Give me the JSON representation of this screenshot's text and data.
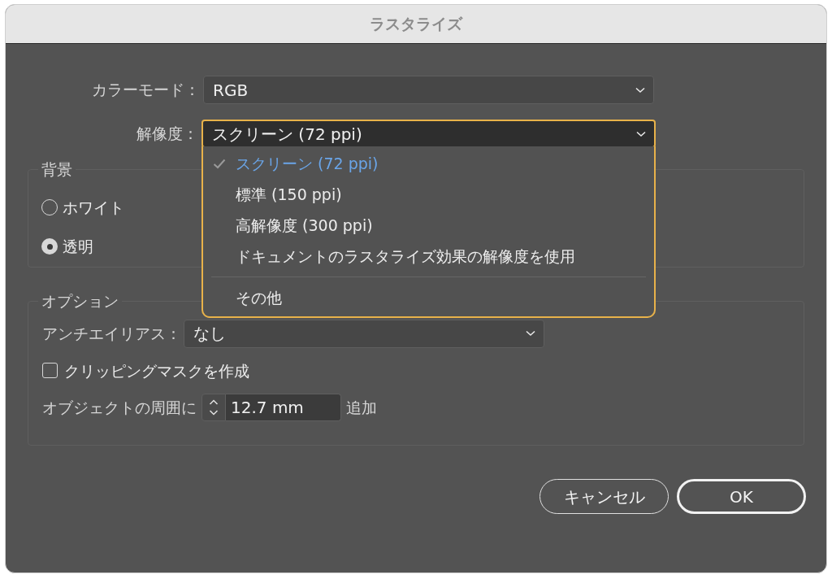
{
  "window": {
    "title": "ラスタライズ"
  },
  "color_mode": {
    "label": "カラーモード：",
    "value": "RGB"
  },
  "resolution": {
    "label": "解像度：",
    "value": "スクリーン (72 ppi)",
    "expanded": true,
    "options": [
      {
        "kind": "option",
        "label": "スクリーン (72 ppi)",
        "selected": true
      },
      {
        "kind": "option",
        "label": "標準 (150 ppi)",
        "selected": false
      },
      {
        "kind": "option",
        "label": "高解像度 (300 ppi)",
        "selected": false
      },
      {
        "kind": "option",
        "label": "ドキュメントのラスタライズ効果の解像度を使用",
        "selected": false
      },
      {
        "kind": "separator"
      },
      {
        "kind": "option",
        "label": "その他",
        "selected": false
      }
    ]
  },
  "background": {
    "legend": "背景",
    "options": [
      {
        "label": "ホワイト",
        "selected": false
      },
      {
        "label": "透明",
        "selected": true
      }
    ]
  },
  "options_group": {
    "legend": "オプション",
    "anti_alias": {
      "label": "アンチエイリアス：",
      "value": "なし"
    },
    "clipping_mask": {
      "label": "クリッピングマスクを作成",
      "checked": false
    },
    "padding": {
      "label": "オブジェクトの周囲に",
      "value": "12.7 mm",
      "suffix": "追加"
    }
  },
  "buttons": [
    {
      "label": "キャンセル",
      "default": false
    },
    {
      "label": "OK",
      "default": true
    }
  ]
}
